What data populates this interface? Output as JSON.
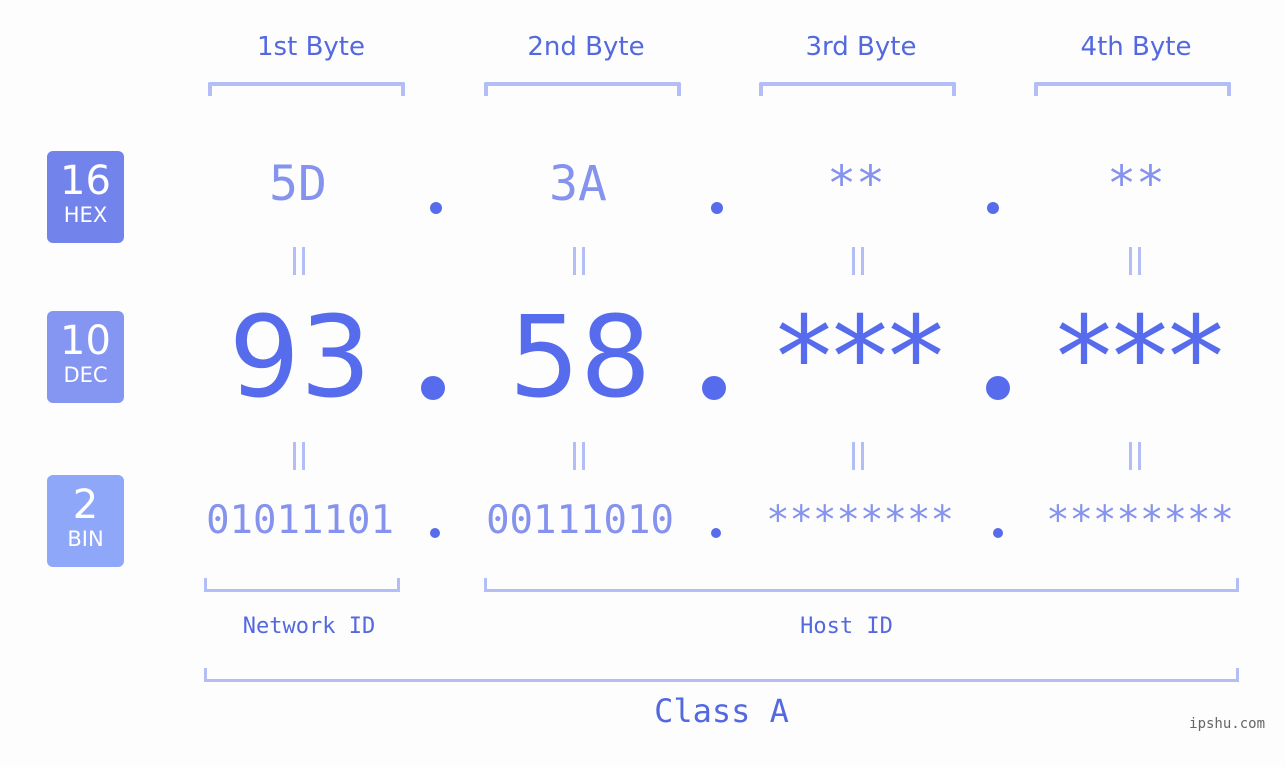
{
  "bytes": [
    {
      "label": "1st Byte",
      "hex": "5D",
      "dec": "93",
      "bin": "01011101"
    },
    {
      "label": "2nd Byte",
      "hex": "3A",
      "dec": "58",
      "bin": "00111010"
    },
    {
      "label": "3rd Byte",
      "hex": "**",
      "dec": "***",
      "bin": "********"
    },
    {
      "label": "4th Byte",
      "hex": "**",
      "dec": "***",
      "bin": "********"
    }
  ],
  "bases": {
    "hex": {
      "number": "16",
      "label": "HEX",
      "color": "#7383ec"
    },
    "dec": {
      "number": "10",
      "label": "DEC",
      "color": "#8595f2"
    },
    "bin": {
      "number": "2",
      "label": "BIN",
      "color": "#8fa7f8"
    }
  },
  "ids": {
    "network": "Network ID",
    "host": "Host ID"
  },
  "class_label": "Class A",
  "watermark": "ipshu.com",
  "colors": {
    "accent": "#566ced",
    "label": "#5468e0",
    "light_value": "#8593ee",
    "bracket": "#b3bdf6"
  }
}
